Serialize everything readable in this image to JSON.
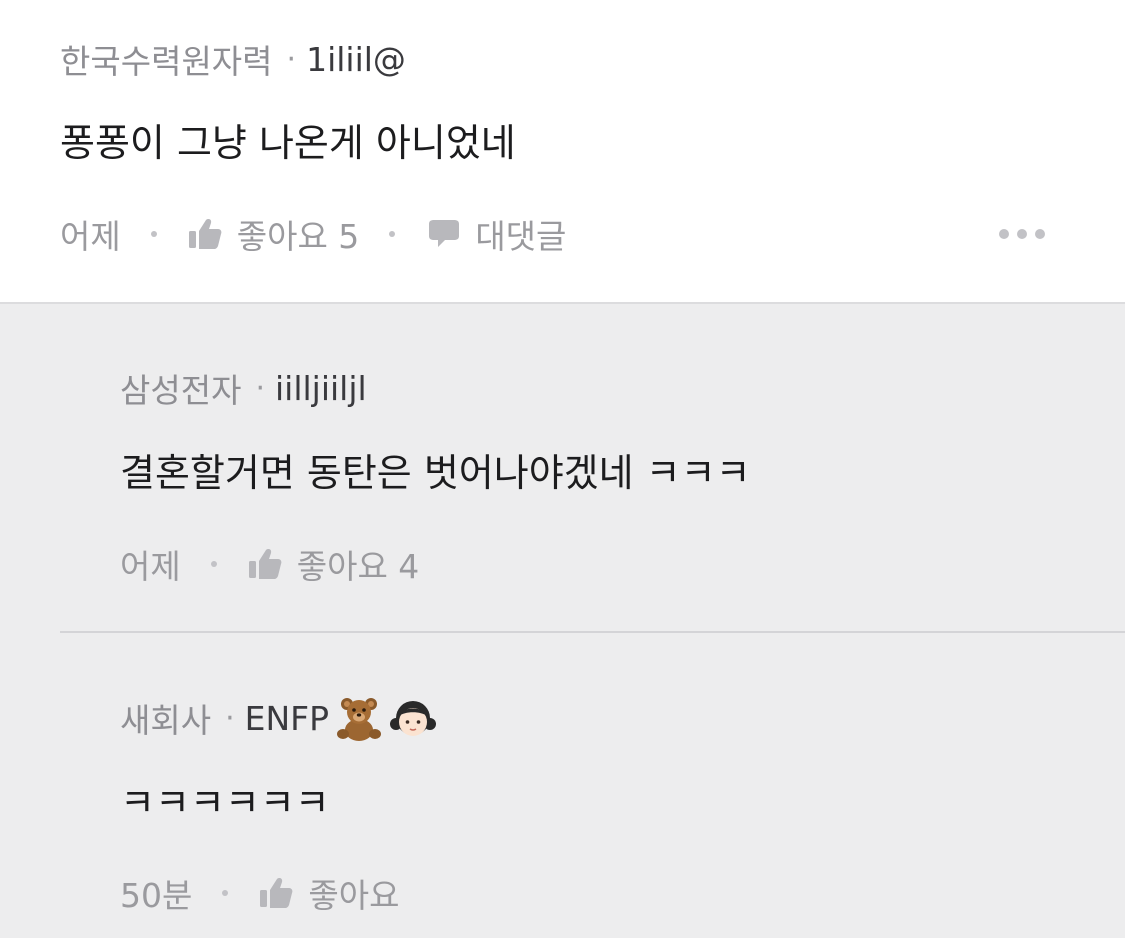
{
  "comments": [
    {
      "company": "한국수력원자력",
      "nickname": "1iliil@",
      "body": "퐁퐁이 그냥 나온게 아니었네",
      "time": "어제",
      "like_label": "좋아요 5",
      "reply_label": "대댓글"
    }
  ],
  "replies": [
    {
      "company": "삼성전자",
      "nickname": "iilljiiljl",
      "body": "결혼할거면 동탄은 벗어나야겠네 ㅋㅋㅋ",
      "time": "어제",
      "like_label": "좋아요 4"
    },
    {
      "company": "새회사",
      "nickname": "ENFP",
      "nickname_emojis": [
        "teddy-bear",
        "girl"
      ],
      "body": "ㅋㅋㅋㅋㅋㅋ",
      "time": "50분",
      "like_label": "좋아요"
    }
  ],
  "separator": "·",
  "icons": {
    "like": "thumbs-up-icon",
    "reply": "speech-bubble-icon",
    "more": "more-options-icon"
  },
  "colors": {
    "reply_background": "#ededee",
    "meta_text": "#9a9a9e",
    "body_text": "#1c1c1e"
  }
}
